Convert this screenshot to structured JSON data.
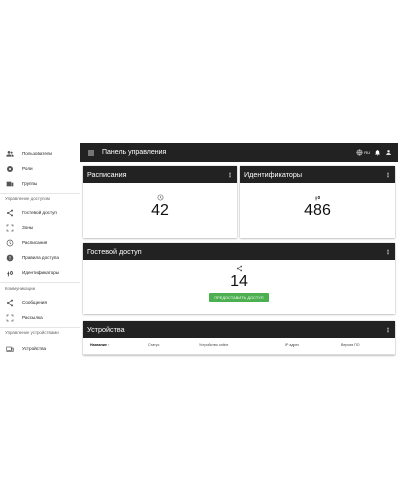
{
  "header": {
    "title": "Панель управления",
    "language": "RU",
    "menu_icon": "menu-icon",
    "globe_icon": "globe-icon",
    "bell_icon": "bell-icon",
    "user_icon": "account-icon",
    "background": "#222222"
  },
  "sidebar": {
    "items_top": [
      {
        "label": "Пользователи",
        "icon": "users-icon"
      },
      {
        "label": "Роли",
        "icon": "roles-icon"
      },
      {
        "label": "Группы",
        "icon": "groups-icon"
      }
    ],
    "access_section": {
      "title": "Управление доступом",
      "items": [
        {
          "label": "Гостевой доступ",
          "icon": "share-icon"
        },
        {
          "label": "Зоны",
          "icon": "zones-icon"
        },
        {
          "label": "Расписания",
          "icon": "clock-icon"
        },
        {
          "label": "Правила доступа",
          "icon": "rules-icon"
        },
        {
          "label": "Идентификаторы",
          "icon": "fingerprint-icon"
        }
      ]
    },
    "comm_section": {
      "title": "Коммуникации",
      "items": [
        {
          "label": "Сообщения",
          "icon": "share-icon"
        },
        {
          "label": "Рассылка",
          "icon": "broadcast-icon"
        }
      ]
    },
    "devices_section": {
      "title": "Управление устройствами",
      "items": [
        {
          "label": "Устройства",
          "icon": "devices-icon"
        }
      ]
    }
  },
  "cards": {
    "schedules": {
      "title": "Расписания",
      "value": "42",
      "icon": "clock-icon"
    },
    "identifiers": {
      "title": "Идентификаторы",
      "value": "486",
      "icon": "fingerprint-icon"
    },
    "guest_access": {
      "title": "Гостевой доступ",
      "value": "14",
      "icon": "share-icon",
      "button_label": "ПРЕДОСТАВИТЬ ДОСТУП",
      "button_color": "#4caf50"
    },
    "devices": {
      "title": "Устройства",
      "columns": [
        "Название",
        "Статус",
        "Устройство online",
        "IP адрес",
        "Версия ПО"
      ],
      "sort_indicator": "↑"
    }
  }
}
